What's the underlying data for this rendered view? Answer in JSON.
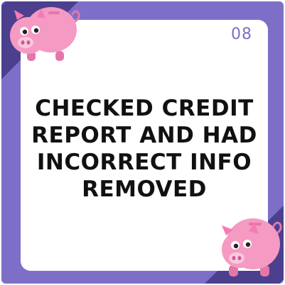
{
  "card": {
    "step_number": "08",
    "lines": [
      "CHECKED CREDIT",
      "REPORT AND HAD",
      "INCORRECT INFO",
      "REMOVED"
    ]
  },
  "colors": {
    "frame": "#7d6fc8",
    "corner_dark": "#4b3f8e",
    "panel": "#ffffff",
    "step_number": "#7d6fc8",
    "text": "#111111",
    "pig_body": "#f59ac3",
    "pig_shade": "#e377aa",
    "pig_ear": "#f77ab5",
    "snout": "#f8c8de"
  },
  "icons": [
    "piggy-bank-icon-top-left",
    "piggy-bank-icon-bottom-right"
  ]
}
